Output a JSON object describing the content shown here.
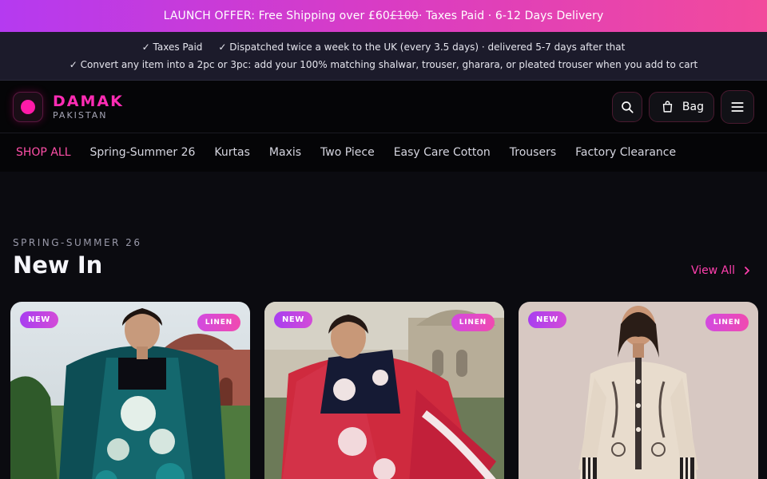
{
  "promo": {
    "prefix": "LAUNCH OFFER: Free Shipping over £60 ",
    "strike": "£100",
    "suffix": " · Taxes Paid · 6-12 Days Delivery"
  },
  "info": {
    "taxes": "✓ Taxes Paid",
    "dispatch": "✓ Dispatched twice a week to the UK (every 3.5 days) · delivered 5-7 days after that",
    "convert": "✓ Convert any item into a 2pc or 3pc: add your 100% matching shalwar, trouser, gharara, or pleated trouser when you add to cart"
  },
  "brand": {
    "name": "DAMAK",
    "sub": "PAKISTAN"
  },
  "header": {
    "bag_label": "Bag"
  },
  "nav": [
    {
      "label": "SHOP ALL",
      "active": true
    },
    {
      "label": "Spring-Summer 26"
    },
    {
      "label": "Kurtas"
    },
    {
      "label": "Maxis"
    },
    {
      "label": "Two Piece"
    },
    {
      "label": "Easy Care Cotton"
    },
    {
      "label": "Trousers"
    },
    {
      "label": "Factory Clearance"
    }
  ],
  "section": {
    "eyebrow": "SPRING-SUMMER 26",
    "title": "New In",
    "view_all": "View All"
  },
  "products": [
    {
      "badge": "NEW",
      "fabric": "LINEN"
    },
    {
      "badge": "NEW",
      "fabric": "LINEN"
    },
    {
      "badge": "NEW",
      "fabric": "LINEN"
    }
  ],
  "colors": {
    "accent": "#ff2cb4",
    "promo_start": "#b53af0",
    "promo_end": "#f24a9c"
  }
}
